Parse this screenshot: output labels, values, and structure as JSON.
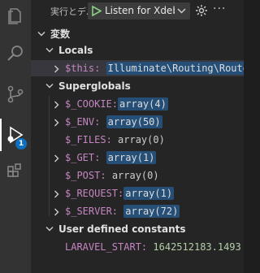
{
  "toolbar": {
    "title": "実行とデバッグ",
    "config_name": "Listen for Xdebug",
    "play_icon": "play-icon",
    "chevron_icon": "chevron-down-icon",
    "gear_icon": "gear-icon",
    "more_label": "···"
  },
  "activity_bar": {
    "items": [
      {
        "name": "explorer-icon"
      },
      {
        "name": "search-icon"
      },
      {
        "name": "source-control-icon"
      },
      {
        "name": "run-debug-icon",
        "badge": "1"
      },
      {
        "name": "extensions-icon"
      }
    ],
    "accent": "#0e70c0"
  },
  "variables": {
    "header": "変数",
    "locals": {
      "label": "Locals",
      "items": [
        {
          "name": "$this:",
          "value": "Illuminate\\Routing\\Route"
        }
      ]
    },
    "superglobals": {
      "label": "Superglobals",
      "items": [
        {
          "name": "$_COOKIE:",
          "value": "array(4)"
        },
        {
          "name": "$_ENV:",
          "value": "array(50)"
        },
        {
          "name": "$_FILES:",
          "value": "array(0)"
        },
        {
          "name": "$_GET:",
          "value": "array(1)"
        },
        {
          "name": "$_POST:",
          "value": "array(0)"
        },
        {
          "name": "$_REQUEST:",
          "value": "array(1)"
        },
        {
          "name": "$_SERVER:",
          "value": "array(72)"
        }
      ]
    },
    "constants": {
      "label": "User defined constants",
      "items": [
        {
          "name": "LARAVEL_START:",
          "value": "1642512183.1493"
        }
      ]
    }
  },
  "colors": {
    "variable_name": "#c586c0",
    "number": "#b5cea8",
    "highlight": "#264f78",
    "play": "#89d185"
  }
}
